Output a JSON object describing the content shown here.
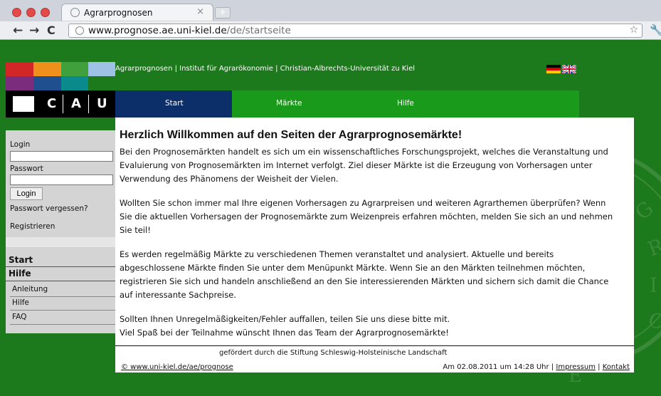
{
  "browser": {
    "tab_title": "Agrarprognosen",
    "close_glyph": "×",
    "url_host": "www.prognose.ae.uni-kiel.de",
    "url_path": "/de/startseite"
  },
  "header": {
    "logo_text": [
      "C",
      "A",
      "U"
    ],
    "top_links": "Agrarprognosen | Institut für Agrarökonomie | Christian-Albrechts-Universität zu Kiel",
    "nav": [
      {
        "label": "Start",
        "color": "#0c2f6a"
      },
      {
        "label": "Märkte",
        "color": "#1a9a1a"
      },
      {
        "label": "Hilfe",
        "color": "#1a9a1a"
      }
    ]
  },
  "sidebar": {
    "login_label": "Login",
    "password_label": "Passwort",
    "login_button": "Login",
    "forgot_password": "Passwort vergessen?",
    "register": "Registrieren",
    "menu_start": "Start",
    "menu_help": "Hilfe",
    "submenu": [
      "Anleitung",
      "Hilfe",
      "FAQ"
    ]
  },
  "main": {
    "title": "Herzlich Willkommen auf den Seiten der Agrarprognosemärkte!",
    "paragraphs": [
      "Bei den Prognosemärkten handelt es sich um ein wissenschaftliches Forschungsprojekt, welches die Veranstaltung und Evaluierung von Prognosemärkten im Internet verfolgt. Ziel dieser Märkte ist die Erzeugung von Vorhersagen unter Verwendung des Phänomens der Weisheit der Vielen.",
      "Wollten Sie schon immer mal Ihre eigenen Vorhersagen zu Agrarpreisen und weiteren Agrarthemen überprüfen? Wenn Sie die aktuellen Vorhersagen der Prognosemärkte zum Weizenpreis erfahren möchten, melden Sie sich an und nehmen Sie teil!",
      "Es werden regelmäßig Märkte zu verschiedenen Themen veranstaltet und analysiert. Aktuelle und bereits abgeschlossene Märkte finden Sie unter dem Menüpunkt Märkte. Wenn Sie an den Märkten teilnehmen möchten, registrieren Sie sich und handeln anschließend an den Sie interessierenden Märkten und sichern sich damit die Chance auf interessante Sachpreise.",
      "Sollten Ihnen Unregelmäßigkeiten/Fehler auffallen, teilen Sie uns diese bitte mit.",
      "Viel Spaß bei der Teilnahme wünscht Ihnen das Team der Agrarprognosemärkte!"
    ]
  },
  "footer": {
    "sponsor": "gefördert durch die Stiftung Schleswig-Holsteinische Landschaft",
    "copyright": "© www.uni-kiel.de/ae/prognose",
    "date_text": "Am 02.08.2011 um 14:28 Uhr |",
    "impressum": "Impressum",
    "separator": "|",
    "kontakt": "Kontakt"
  },
  "colors": {
    "site_green": "#1c7a1c",
    "nav_blue": "#0c2f6a",
    "nav_green": "#1a9a1a"
  }
}
